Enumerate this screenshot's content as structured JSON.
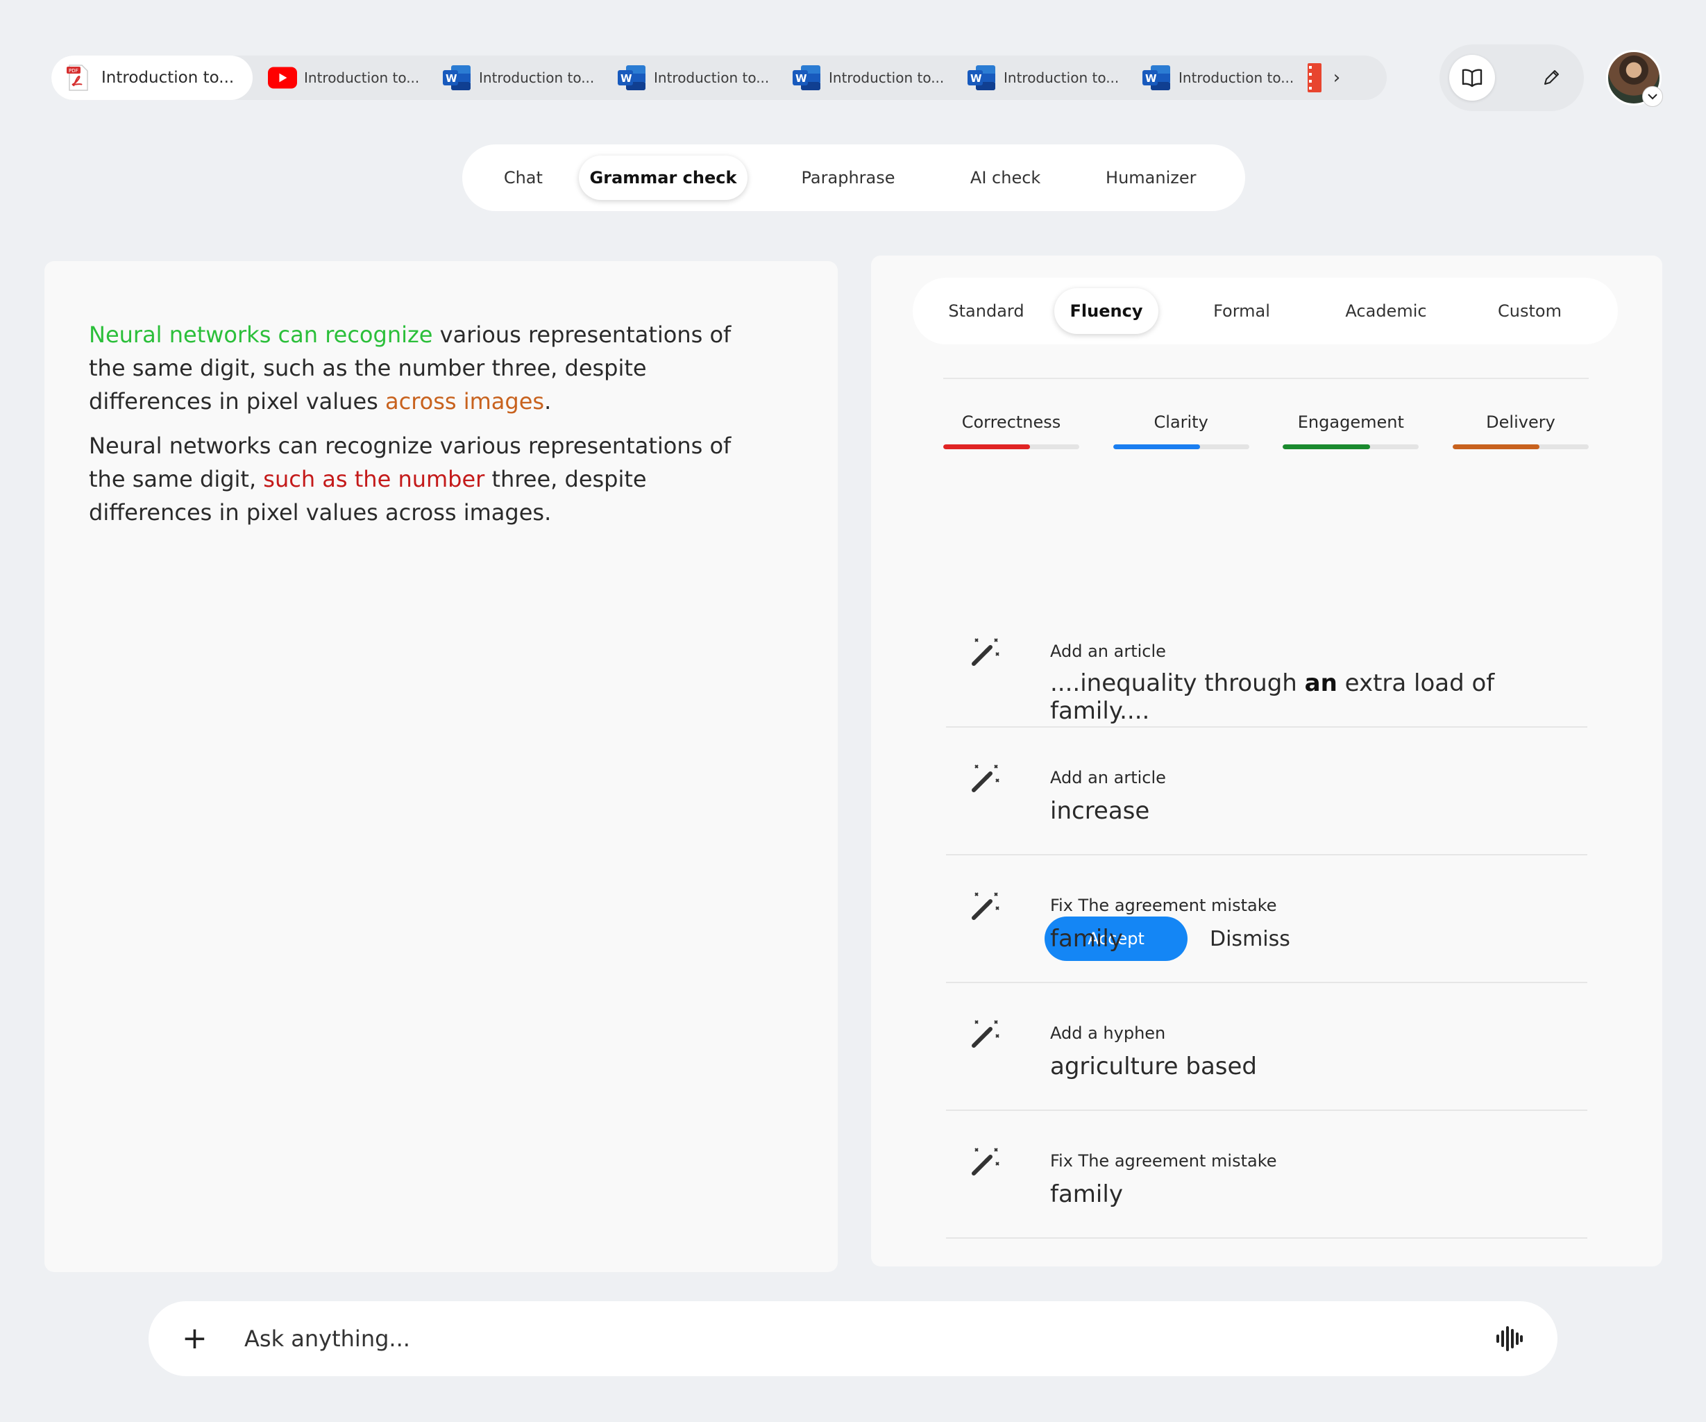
{
  "tabs": [
    {
      "label": "Introduction to...",
      "icon": "pdf-icon",
      "active": true
    },
    {
      "label": "Introduction to...",
      "icon": "youtube-icon",
      "active": false
    },
    {
      "label": "Introduction to...",
      "icon": "word-icon",
      "active": false
    },
    {
      "label": "Introduction to...",
      "icon": "word-icon",
      "active": false
    },
    {
      "label": "Introduction to...",
      "icon": "word-icon",
      "active": false
    },
    {
      "label": "Introduction to...",
      "icon": "word-icon",
      "active": false
    },
    {
      "label": "Introduction to...",
      "icon": "word-icon",
      "active": false
    }
  ],
  "tab_more_label": "›",
  "tools": {
    "reader_icon": "book-open-icon",
    "edit_icon": "pencil-icon"
  },
  "modes": [
    {
      "label": "Chat",
      "active": false
    },
    {
      "label": "Grammar check",
      "active": true
    },
    {
      "label": "Paraphrase",
      "active": false
    },
    {
      "label": "AI check",
      "active": false
    },
    {
      "label": "Humanizer",
      "active": false
    }
  ],
  "editor": {
    "p1": {
      "green": "Neural networks can recognize",
      "mid": " various representations of the same digit, such as the number three, despite differences in pixel values ",
      "orange": "across images",
      "end": "."
    },
    "p2": {
      "start": "Neural networks can recognize various representations of the same digit, ",
      "red": "such as the number",
      "end": " three, despite differences in pixel values across images."
    }
  },
  "styles": [
    {
      "label": "Standard",
      "active": false
    },
    {
      "label": "Fluency",
      "active": true
    },
    {
      "label": "Formal",
      "active": false
    },
    {
      "label": "Academic",
      "active": false
    },
    {
      "label": "Custom",
      "active": false
    }
  ],
  "metrics": [
    {
      "label": "Correctness",
      "value": 0.64,
      "color": "#e02424"
    },
    {
      "label": "Clarity",
      "value": 0.64,
      "color": "#1a7ef0"
    },
    {
      "label": "Engagement",
      "value": 0.64,
      "color": "#1a8a2e"
    },
    {
      "label": "Delivery",
      "value": 0.64,
      "color": "#c8621e"
    }
  ],
  "suggestions": {
    "first": {
      "category": "Add an article",
      "before": "....inequality through ",
      "bold": "an",
      "after": " extra load of family....",
      "accept_label": "Accept",
      "dismiss_label": "Dismiss"
    },
    "rows": [
      {
        "category": "Add an article",
        "text": "increase"
      },
      {
        "category": "Fix The agreement mistake",
        "text": "family"
      },
      {
        "category": "Add a hyphen",
        "text": "agriculture based"
      },
      {
        "category": "Fix The agreement mistake",
        "text": "family"
      }
    ]
  },
  "askbar": {
    "placeholder": "Ask anything...",
    "plus_label": "+"
  },
  "colors": {
    "accent": "#1486f5",
    "background": "#eef0f3"
  }
}
